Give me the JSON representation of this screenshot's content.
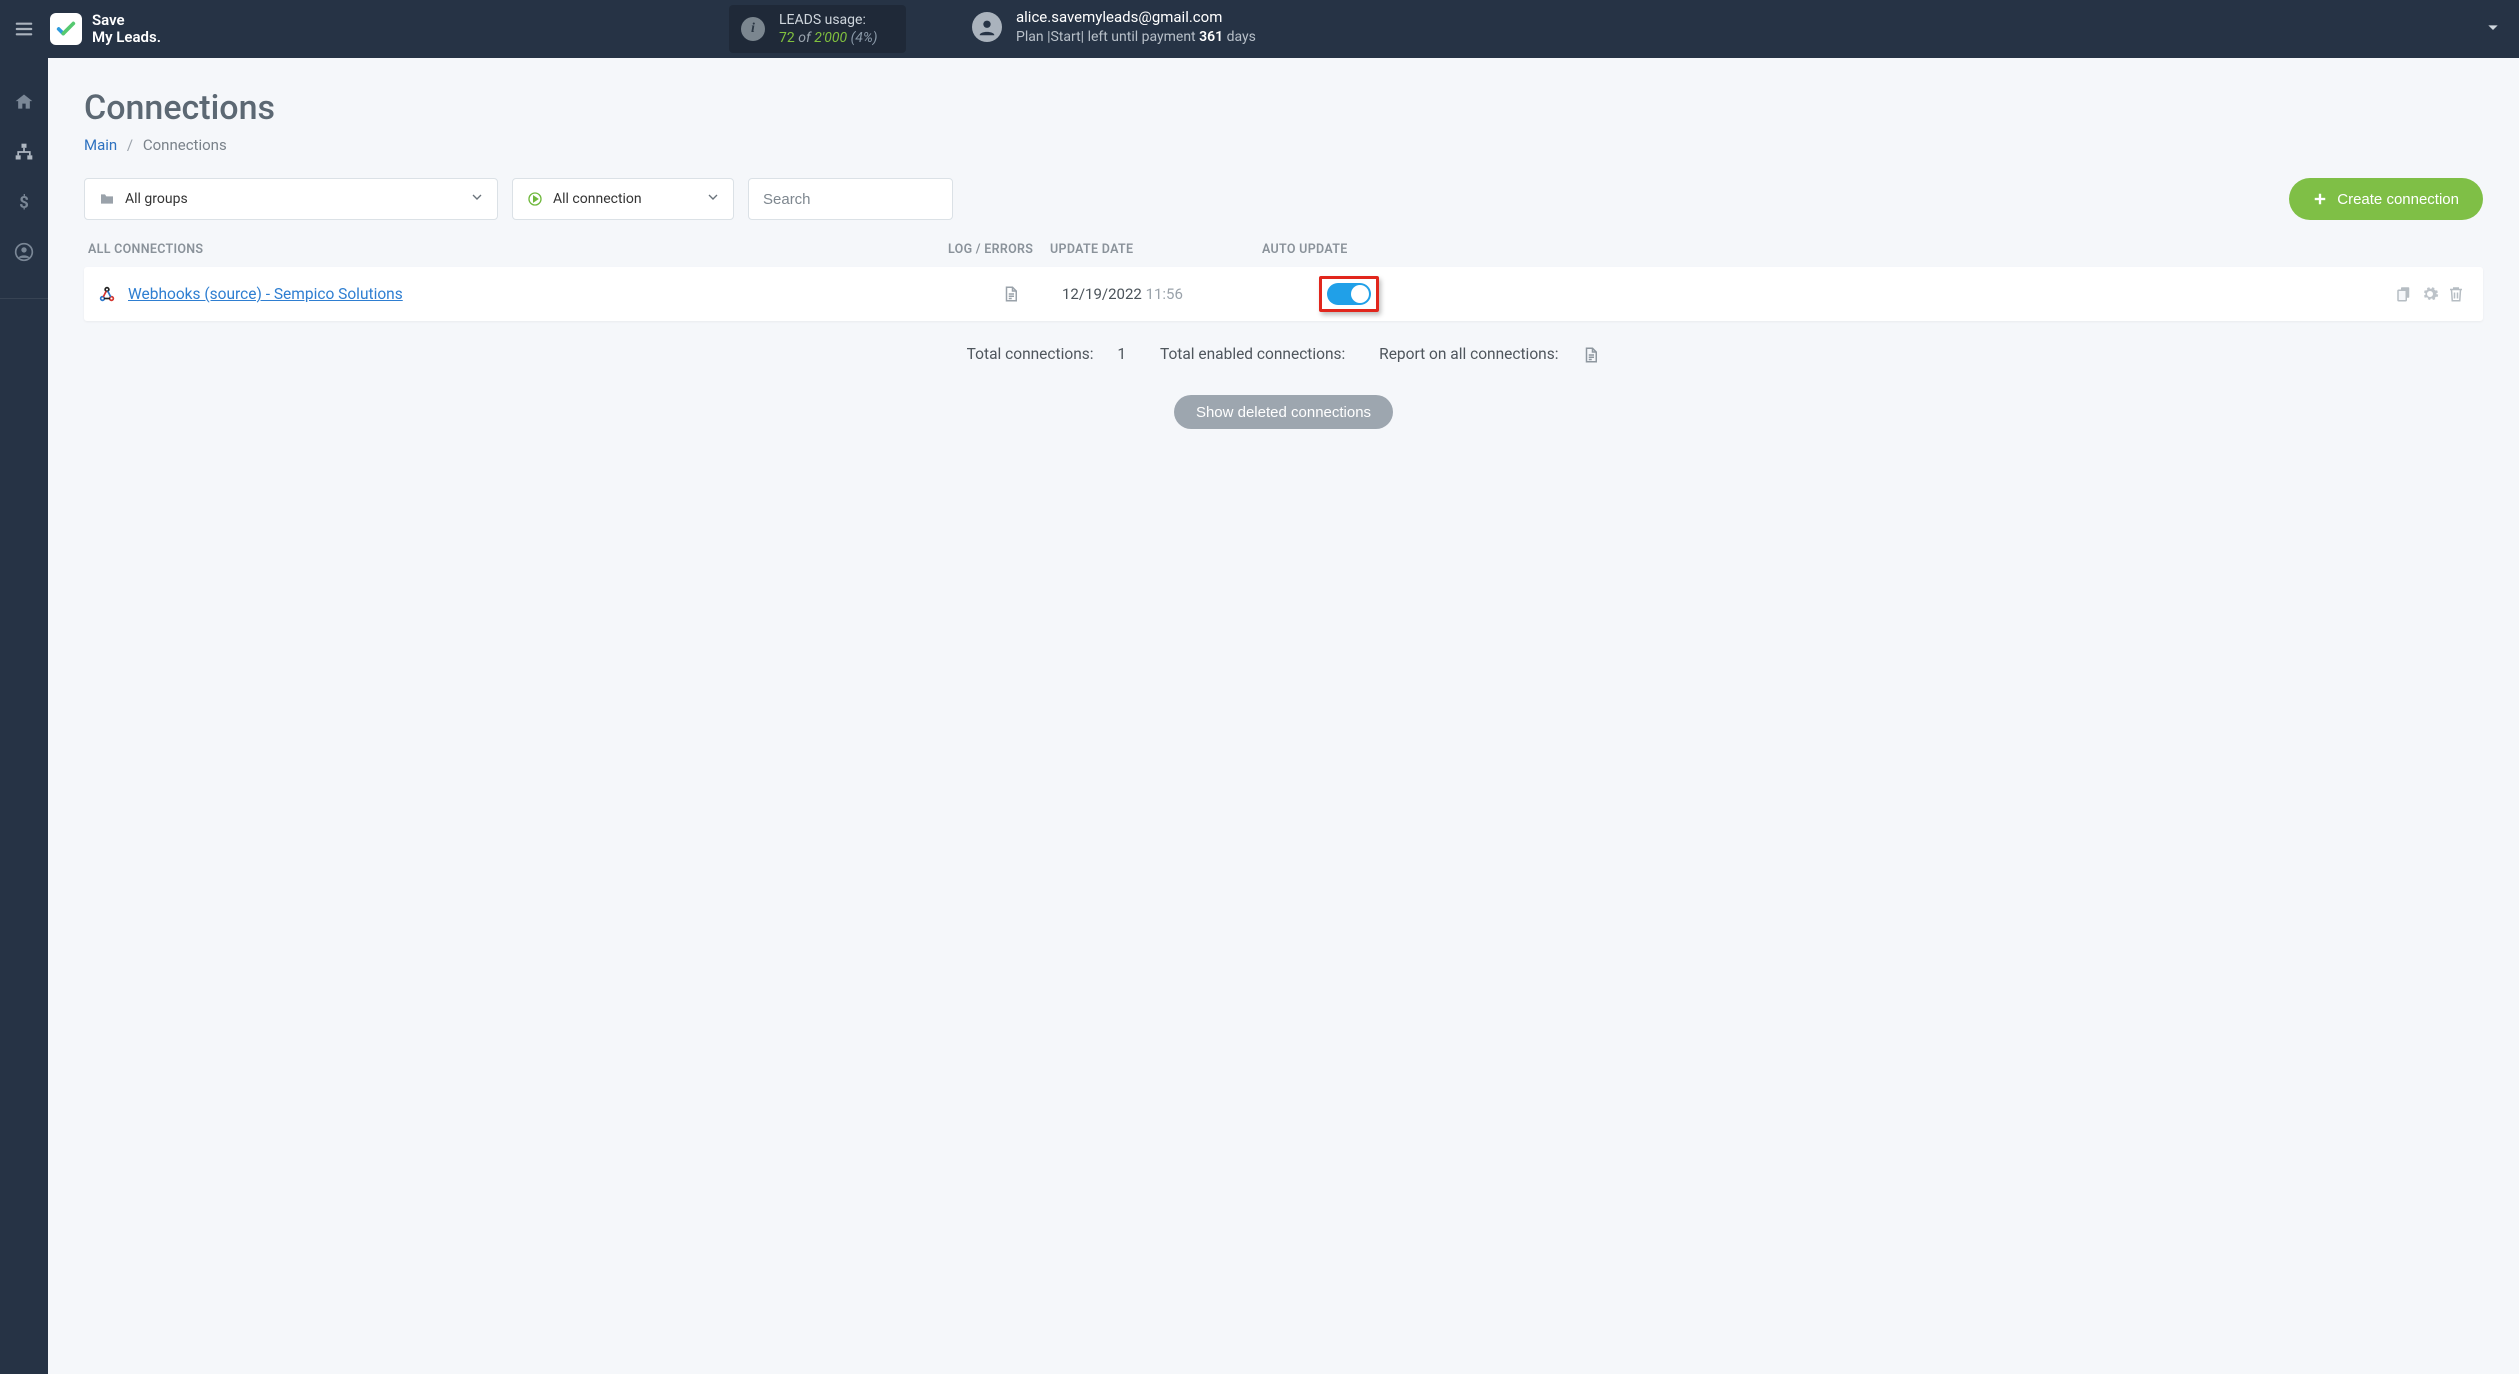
{
  "header": {
    "logo_line1": "Save",
    "logo_line2": "My Leads.",
    "leads_label": "LEADS usage:",
    "leads_used": "72",
    "leads_of": "of",
    "leads_limit": "2'000",
    "leads_pct": "(4%)",
    "user_email": "alice.savemyleads@gmail.com",
    "plan_prefix": "Plan",
    "plan_name": "Start",
    "plan_mid": "left until payment",
    "plan_days": "361",
    "plan_suffix": "days"
  },
  "page": {
    "title": "Connections",
    "crumb_main": "Main",
    "crumb_current": "Connections"
  },
  "filters": {
    "groups_label": "All groups",
    "connection_label": "All connection",
    "search_placeholder": "Search",
    "create_label": "Create connection"
  },
  "columns": {
    "all": "All connections",
    "log": "Log / Errors",
    "update": "Update date",
    "auto": "Auto update"
  },
  "rows": [
    {
      "name": "Webhooks (source) - Sempico Solutions",
      "date": "12/19/2022",
      "time": "11:56",
      "enabled": true
    }
  ],
  "summary": {
    "total_label": "Total connections:",
    "total_value": "1",
    "enabled_label": "Total enabled connections:",
    "report_label": "Report on all connections:"
  },
  "deleted_btn": "Show deleted connections"
}
